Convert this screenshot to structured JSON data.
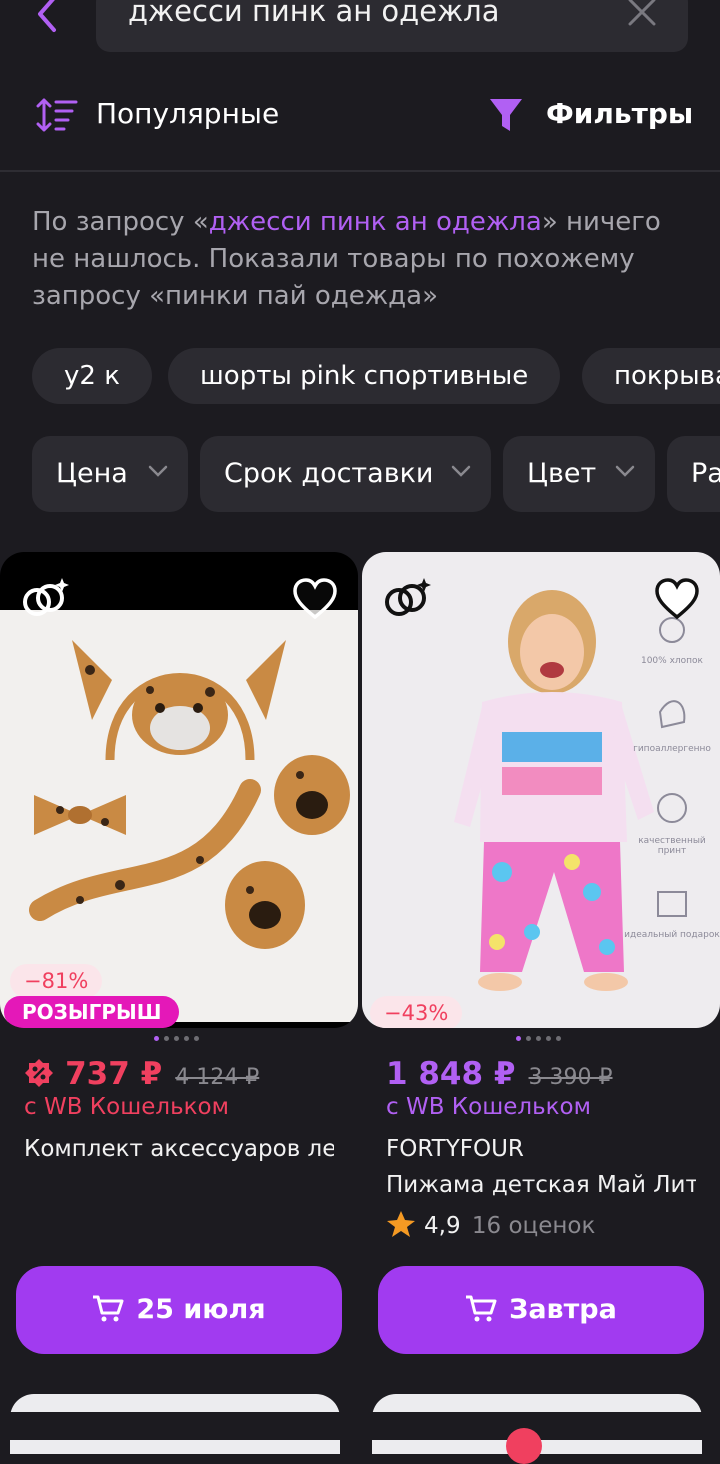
{
  "search": {
    "query": "джесси пинк ан одежла"
  },
  "toolbar": {
    "sort_label": "Популярные",
    "filter_label": "Фильтры"
  },
  "notice": {
    "prefix": "По запросу «",
    "query": "джесси пинк ан одежла",
    "suffix": "» ничего не нашлось. Показали товары по похожему запросу «пинки пай одежда»"
  },
  "suggestions": [
    "y2 к",
    "шорты pink спортивные",
    "покрывало"
  ],
  "filters": [
    "Цена",
    "Срок доставки",
    "Цвет",
    "Ра"
  ],
  "products": [
    {
      "discount": "−81%",
      "promo": "РОЗЫГРЫШ",
      "price": "737 ₽",
      "old_price": "4 124 ₽",
      "wallet": "с WB Кошельком",
      "brand": "",
      "name": "Комплект аксессуаров леопард",
      "delivery": "25 июля"
    },
    {
      "discount": "−43%",
      "price": "1 848 ₽",
      "old_price": "3 390 ₽",
      "wallet": "с WB Кошельком",
      "brand": "FORTYFOUR",
      "name": "Пижама детская Май Литл Пони",
      "rating": "4,9",
      "reviews": "16 оценок",
      "delivery": "Завтра",
      "image_labels": [
        "100% хлопок",
        "гипоаллергенно",
        "качественный принт",
        "идеальный подарок"
      ]
    }
  ],
  "colors": {
    "accent": "#a13bf0",
    "link": "#b160f3",
    "sale": "#f0405f",
    "promo": "#e418b8",
    "background": "#1c1b20"
  },
  "icons": {
    "back": "chevron-left-icon",
    "clear": "close-icon",
    "sort": "sort-icon",
    "filter": "funnel-icon",
    "favorite": "heart-icon",
    "similar": "rings-icon",
    "cart": "cart-icon",
    "star": "star-icon"
  }
}
